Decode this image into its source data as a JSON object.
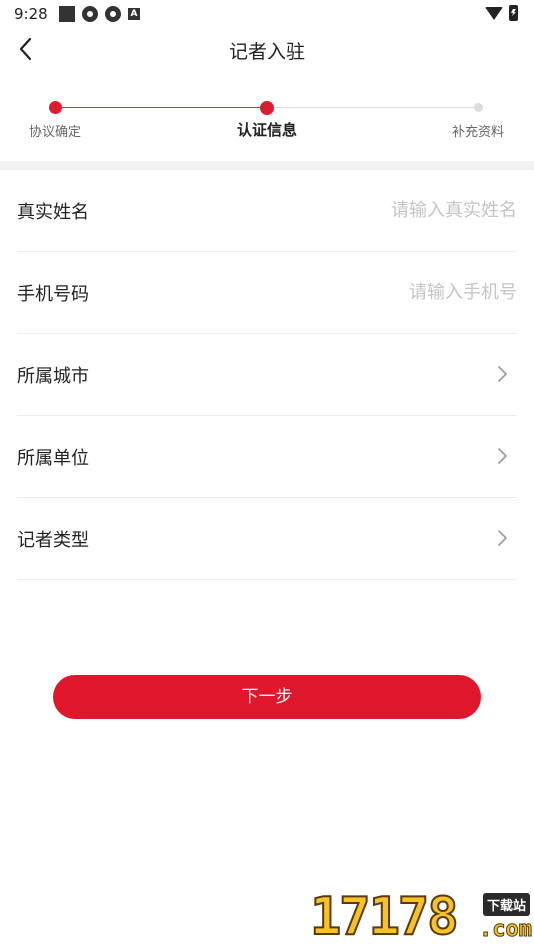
{
  "status_bar": {
    "time": "9:28",
    "icons_left": [
      "square-icon",
      "gear-icon",
      "gear-icon",
      "a-letter-icon"
    ],
    "a_icon_text": "A",
    "icons_right": [
      "wifi-icon",
      "battery-icon"
    ]
  },
  "header": {
    "title": "记者入驻",
    "back_icon": "chevron-left-icon"
  },
  "stepper": {
    "active_color": "#e01b30",
    "inactive_color": "#dddddd",
    "current_step": 2,
    "steps": [
      {
        "label": "协议确定",
        "state": "done"
      },
      {
        "label": "认证信息",
        "state": "active"
      },
      {
        "label": "补充资料",
        "state": "pending"
      }
    ]
  },
  "form": {
    "rows": [
      {
        "label": "真实姓名",
        "type": "input",
        "value": "",
        "placeholder": "请输入真实姓名"
      },
      {
        "label": "手机号码",
        "type": "input",
        "value": "",
        "placeholder": "请输入手机号"
      },
      {
        "label": "所属城市",
        "type": "select",
        "icon": "chevron-right-icon"
      },
      {
        "label": "所属单位",
        "type": "select",
        "icon": "chevron-right-icon"
      },
      {
        "label": "记者类型",
        "type": "select",
        "icon": "chevron-right-icon"
      }
    ]
  },
  "actions": {
    "next_label": "下一步",
    "button_color": "#e0162b"
  },
  "watermark": {
    "digits": "17178",
    "tag": "下载站",
    "suffix": ".com"
  }
}
